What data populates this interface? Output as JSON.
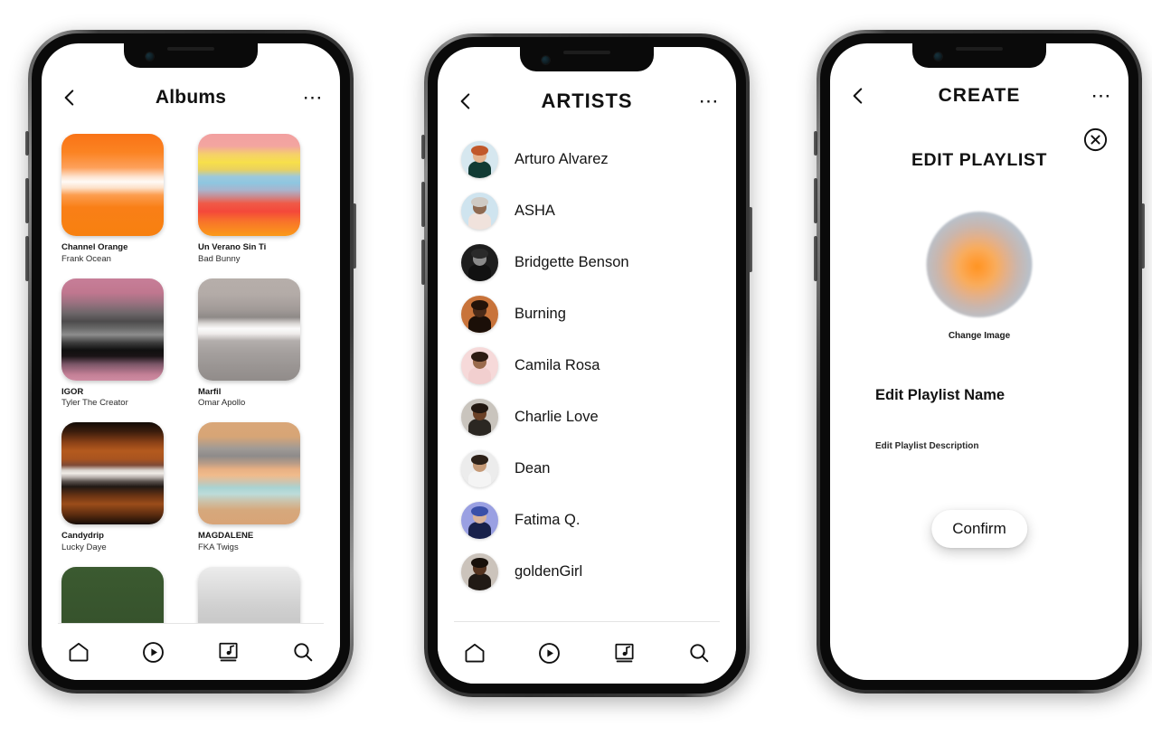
{
  "phones": [
    {
      "id": "albums",
      "appbar": {
        "back_icon": "chevron-left-icon",
        "title": "Albums",
        "more_icon": "more-horizontal-icon"
      },
      "albums": [
        {
          "title": "Channel Orange",
          "artist": "Frank Ocean",
          "gradient": "linear-gradient(180deg,#f97316 0%,#fb8322 18%,#fda05a 33%,#fde3cf 42%,#fffaf6 47%,#fde0c7 53%,#fc9d4e 60%,#f97f17 72%,#f7800f 100%)"
        },
        {
          "title": "Un Verano Sin Ti",
          "artist": "Bad Bunny",
          "gradient": "linear-gradient(180deg,#f2a0a0 0%,#f3a5a0 12%,#f5d06a 20%,#f7e04a 28%,#ead15f 35%,#9cc9dd 42%,#8ec6e0 48%,#a9b4cd 55%,#c68f96 61%,#ef5a48 68%,#f4483a 76%,#f8742a 86%,#fb9a18 100%)"
        },
        {
          "title": "IGOR",
          "artist": "Tyler The Creator",
          "gradient": "linear-gradient(180deg,#c77e98 0%,#c0778f 14%,#9a7180 24%,#6d6669 34%,#4d4b4c 42%,#6a6a6a 49%,#8d8d8d 55%,#3d3d3d 63%,#101010 70%,#1a1416 76%,#7b5668 84%,#c37f96 94%,#cf8ca2 100%)"
        },
        {
          "title": "Marfil",
          "artist": "Omar Apollo",
          "gradient": "linear-gradient(180deg,#b6aeaa 0%,#b3aba7 16%,#a29b98 30%,#8f8a88 38%,#d9d6d4 44%,#fbfbfb 49%,#efeceb 54%,#b3aeac 61%,#a5a09e 72%,#9a9593 86%,#918c8a 100%)"
        },
        {
          "title": "Candydrip",
          "artist": "Lucky Daye",
          "gradient": "linear-gradient(180deg,#120b06 0%,#3a1c0c 9%,#8c4217 20%,#b45a1e 28%,#a9541f 36%,#7e4a36 42%,#d9d3cd 47%,#f0ece7 50%,#b5aeaa 54%,#5a524e 58%,#201814 63%,#6b3413 72%,#9b4d1a 80%,#5e2d10 90%,#150c06 100%)"
        },
        {
          "title": "MAGDALENE",
          "artist": "FKA Twigs",
          "gradient": "linear-gradient(180deg,#d9a678 0%,#d7a576 14%,#9f9a96 26%,#8e8b8a 33%,#b79b87 40%,#e8b083 46%,#f0bb8c 52%,#cfc4ad 58%,#a9d3d2 64%,#bcdcda 70%,#cbc3ac 77%,#d6a87c 86%,#d8a477 100%)"
        },
        {
          "title": "",
          "artist": "",
          "gradient": "linear-gradient(180deg,#3b5a30 0%,#36522c 60%,#2f4a26 100%)"
        },
        {
          "title": "",
          "artist": "",
          "gradient": "linear-gradient(180deg,#ececec 0%,#cfcfcf 40%,#b7b7b7 100%)"
        }
      ],
      "tabs": [
        {
          "icon": "home-icon",
          "label": "Home"
        },
        {
          "icon": "play-circle-icon",
          "label": "Play"
        },
        {
          "icon": "music-library-icon",
          "label": "Library"
        },
        {
          "icon": "search-icon",
          "label": "Search"
        }
      ]
    },
    {
      "id": "artists",
      "appbar": {
        "back_icon": "chevron-left-icon",
        "title": "ARTISTS",
        "more_icon": "more-horizontal-icon"
      },
      "artists": [
        {
          "name": "Arturo Alvarez",
          "bg": "#d6e7ef",
          "skin": "#e5b48f",
          "hair": "#c1582a",
          "cloth": "#113a33"
        },
        {
          "name": "ASHA",
          "bg": "#cfe4ef",
          "skin": "#8e6a52",
          "hair": "#cfcac4",
          "cloth": "#f0e2dc"
        },
        {
          "name": "Bridgette Benson",
          "bg": "#1d1d1d",
          "skin": "#8a8a8a",
          "hair": "#2a2a2a",
          "cloth": "#111111"
        },
        {
          "name": "Burning",
          "bg": "#c8733a",
          "skin": "#4a2a18",
          "hair": "#231309",
          "cloth": "#1b0f08"
        },
        {
          "name": "Camila Rosa",
          "bg": "#f6d9d9",
          "skin": "#9a6a4c",
          "hair": "#2e1b12",
          "cloth": "#f2cfcf"
        },
        {
          "name": "Charlie Love",
          "bg": "#c9c4bd",
          "skin": "#6b4127",
          "hair": "#231811",
          "cloth": "#2b2722"
        },
        {
          "name": "Dean",
          "bg": "#ececec",
          "skin": "#c59a77",
          "hair": "#2d2118",
          "cloth": "#f4f4f4"
        },
        {
          "name": "Fatima Q.",
          "bg": "#9aa0e2",
          "skin": "#d9b39a",
          "hair": "#3a4fa8",
          "cloth": "#18214a"
        },
        {
          "name": "goldenGirl",
          "bg": "#cbc3bb",
          "skin": "#54331f",
          "hair": "#17100a",
          "cloth": "#211a15"
        }
      ],
      "tabs": [
        {
          "icon": "home-icon",
          "label": "Home"
        },
        {
          "icon": "play-circle-icon",
          "label": "Play"
        },
        {
          "icon": "music-library-icon",
          "label": "Library"
        },
        {
          "icon": "search-icon",
          "label": "Search"
        }
      ]
    },
    {
      "id": "create",
      "appbar": {
        "back_icon": "chevron-left-icon",
        "title": "CREATE",
        "more_icon": "more-horizontal-icon"
      },
      "close_icon": "close-circle-icon",
      "edit_title": "EDIT PLAYLIST",
      "change_image_label": "Change Image",
      "playlist_name": "Edit Playlist Name",
      "playlist_description": "Edit Playlist Description",
      "confirm_label": "Confirm"
    }
  ],
  "colors": {
    "background": "#ffffff",
    "text": "#111111",
    "frame": "#2b2b2b",
    "divider": "#e4e4e4"
  }
}
